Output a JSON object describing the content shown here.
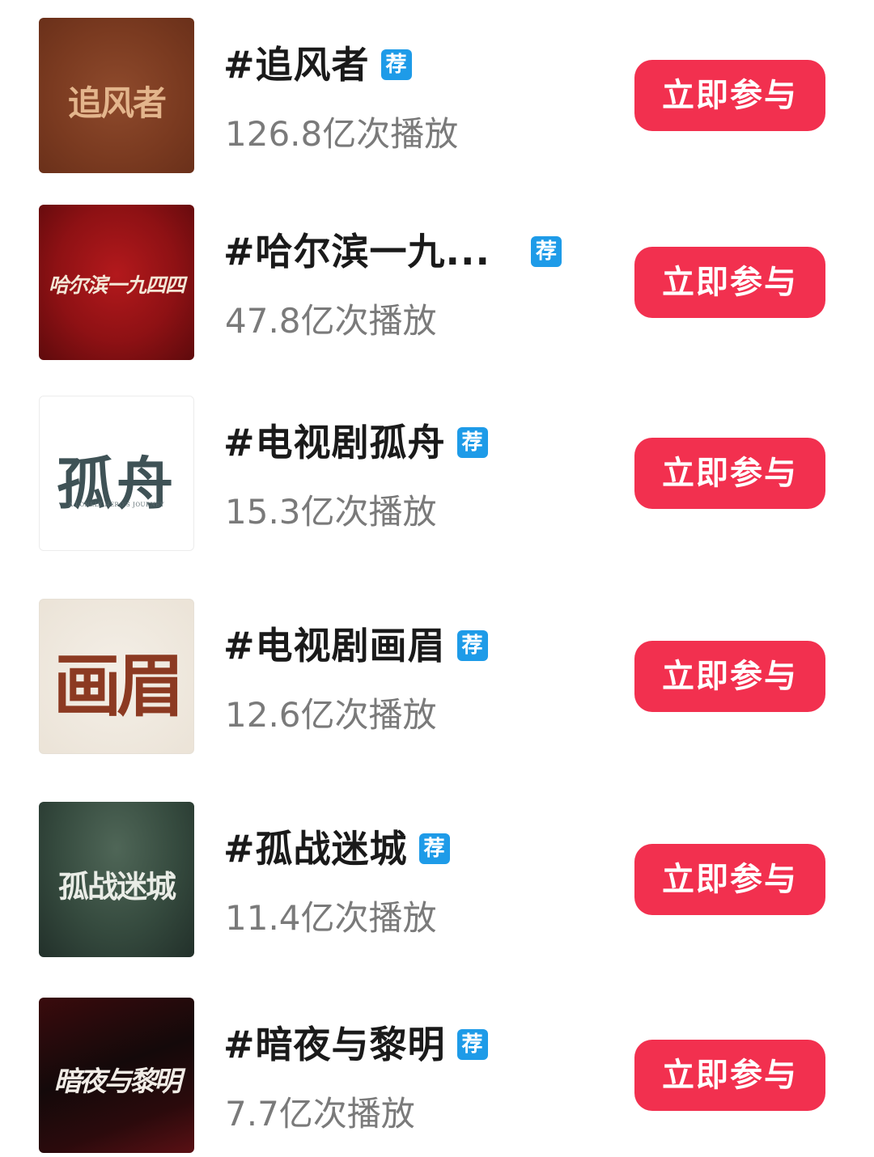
{
  "topics": [
    {
      "title": "#追风者",
      "badge": "荐",
      "plays": "126.8亿次播放",
      "button": "立即参与",
      "poster_text": "追风者",
      "poster_subtext": ""
    },
    {
      "title": "#哈尔滨一九...",
      "badge": "荐",
      "plays": "47.8亿次播放",
      "button": "立即参与",
      "poster_text": "哈尔滨一九四四",
      "poster_subtext": ""
    },
    {
      "title": "#电视剧孤舟",
      "badge": "荐",
      "plays": "15.3亿次播放",
      "button": "立即参与",
      "poster_text": "孤舟",
      "poster_subtext": "A LONELY HERO'S JOURNEY"
    },
    {
      "title": "#电视剧画眉",
      "badge": "荐",
      "plays": "12.6亿次播放",
      "button": "立即参与",
      "poster_text": "画眉",
      "poster_subtext": ""
    },
    {
      "title": "#孤战迷城",
      "badge": "荐",
      "plays": "11.4亿次播放",
      "button": "立即参与",
      "poster_text": "孤战迷城",
      "poster_subtext": ""
    },
    {
      "title": "#暗夜与黎明",
      "badge": "荐",
      "plays": "7.7亿次播放",
      "button": "立即参与",
      "poster_text": "暗夜与黎明",
      "poster_subtext": ""
    }
  ],
  "colors": {
    "button_bg": "#f2304f",
    "badge_bg": "#1e9be8",
    "title_text": "#1a1a1a",
    "plays_text": "#7a7a7a"
  }
}
